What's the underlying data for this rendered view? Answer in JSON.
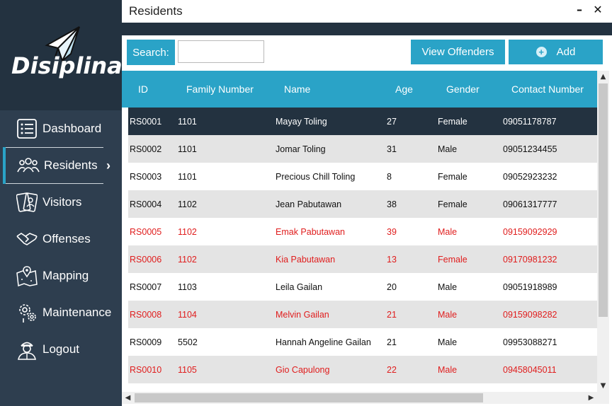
{
  "brand": {
    "logo_text": "Disiplina"
  },
  "sidebar": {
    "items": [
      {
        "label": "Dashboard",
        "icon": "list-icon"
      },
      {
        "label": "Residents",
        "icon": "people-icon",
        "active": true
      },
      {
        "label": "Visitors",
        "icon": "id-cards-icon"
      },
      {
        "label": "Offenses",
        "icon": "handshake-icon"
      },
      {
        "label": "Mapping",
        "icon": "map-pin-icon"
      },
      {
        "label": "Maintenance",
        "icon": "gears-icon"
      },
      {
        "label": "Logout",
        "icon": "user-icon"
      }
    ],
    "active_chevron": "›"
  },
  "window": {
    "title": "Residents",
    "minimize": "–",
    "close": "✕"
  },
  "toolbar": {
    "search_label": "Search:",
    "search_value": "",
    "view_offenders_label": "View Offenders",
    "add_label": "Add"
  },
  "table": {
    "columns": [
      "ID",
      "Family Number",
      "Name",
      "Age",
      "Gender",
      "Contact Number"
    ],
    "rows": [
      {
        "id": "RS0001",
        "family": "1101",
        "name": "Mayay Toling",
        "age": "27",
        "gender": "Female",
        "contact": "09051178787",
        "offender": false
      },
      {
        "id": "RS0002",
        "family": "1101",
        "name": "Jomar Toling",
        "age": "31",
        "gender": "Male",
        "contact": "09051234455",
        "offender": false
      },
      {
        "id": "RS0003",
        "family": "1101",
        "name": "Precious Chill Toling",
        "age": "8",
        "gender": "Female",
        "contact": "09052923232",
        "offender": false
      },
      {
        "id": "RS0004",
        "family": "1102",
        "name": "Jean Pabutawan",
        "age": "38",
        "gender": "Female",
        "contact": "09061317777",
        "offender": false
      },
      {
        "id": "RS0005",
        "family": "1102",
        "name": "Emak Pabutawan",
        "age": "39",
        "gender": "Male",
        "contact": "09159092929",
        "offender": true
      },
      {
        "id": "RS0006",
        "family": "1102",
        "name": "Kia Pabutawan",
        "age": "13",
        "gender": "Female",
        "contact": "09170981232",
        "offender": true
      },
      {
        "id": "RS0007",
        "family": "1103",
        "name": "Leila Gailan",
        "age": "20",
        "gender": "Male",
        "contact": "09051918989",
        "offender": false
      },
      {
        "id": "RS0008",
        "family": "1104",
        "name": "Melvin Gailan",
        "age": "21",
        "gender": "Male",
        "contact": "09159098282",
        "offender": true
      },
      {
        "id": "RS0009",
        "family": "5502",
        "name": "Hannah Angeline Gailan",
        "age": "21",
        "gender": "Male",
        "contact": "09953088271",
        "offender": false
      },
      {
        "id": "RS0010",
        "family": "1105",
        "name": "Gio Capulong",
        "age": "22",
        "gender": "Male",
        "contact": "09458045011",
        "offender": true
      }
    ]
  },
  "colors": {
    "sidebar_bg": "#2e3e4f",
    "dark_band": "#233240",
    "accent": "#2aa3c7",
    "offender_text": "#e01d1d",
    "alt_row": "#e4e4e4"
  }
}
